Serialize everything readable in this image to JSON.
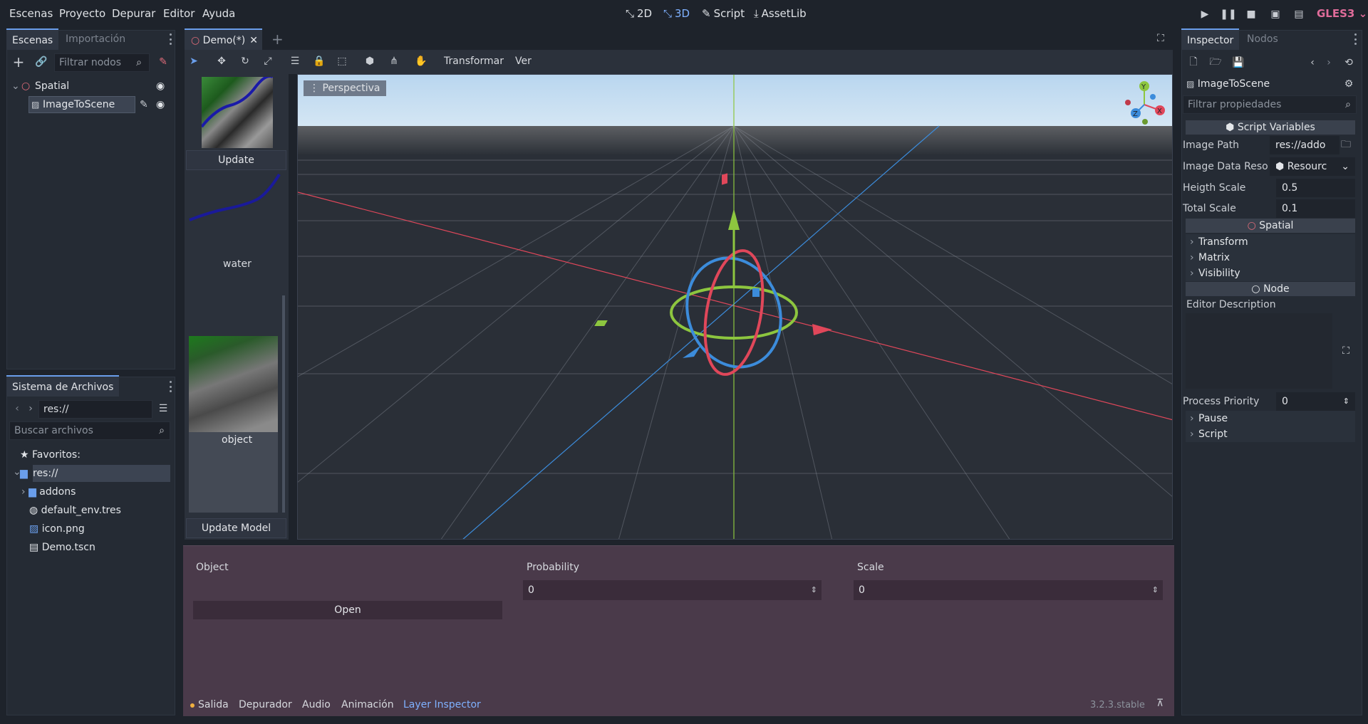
{
  "menu": [
    "Escenas",
    "Proyecto",
    "Depurar",
    "Editor",
    "Ayuda"
  ],
  "modes": {
    "m2d": "2D",
    "m3d": "3D",
    "script": "Script",
    "assetlib": "AssetLib"
  },
  "renderer": "GLES3",
  "scene_panel": {
    "tabs": [
      "Escenas",
      "Importación"
    ],
    "filter_placeholder": "Filtrar nodos",
    "nodes": [
      "Spatial",
      "ImageToScene"
    ]
  },
  "filesystem": {
    "title": "Sistema de Archivos",
    "path": "res://",
    "search_placeholder": "Buscar archivos",
    "items": [
      "Favoritos:",
      "res://",
      "addons",
      "default_env.tres",
      "icon.png",
      "Demo.tscn"
    ]
  },
  "editor_tab": "Demo(*)",
  "toolbar": {
    "transform": "Transformar",
    "view": "Ver"
  },
  "viewport": {
    "label": "Perspectiva"
  },
  "side_panel": {
    "update": "Update",
    "water": "water",
    "object": "object",
    "update_model": "Update Model"
  },
  "bottom_panel": {
    "object_label": "Object",
    "open_button": "Open",
    "probability_label": "Probability",
    "probability_value": "0",
    "scale_label": "Scale",
    "scale_value": "0"
  },
  "bottom_tabs": [
    "Salida",
    "Depurador",
    "Audio",
    "Animación",
    "Layer Inspector"
  ],
  "version": "3.2.3.stable",
  "inspector": {
    "tabs": [
      "Inspector",
      "Nodos"
    ],
    "node_name": "ImageToScene",
    "filter_placeholder": "Filtrar propiedades",
    "script_vars": "Script Variables",
    "props": [
      {
        "label": "Image Path",
        "value": "res://addo"
      },
      {
        "label": "Image Data Reso",
        "value": "Resourc"
      },
      {
        "label": "Heigth Scale",
        "value": "0.5"
      },
      {
        "label": "Total Scale",
        "value": "0.1"
      }
    ],
    "spatial": "Spatial",
    "groups1": [
      "Transform",
      "Matrix",
      "Visibility"
    ],
    "node": "Node",
    "editor_description": "Editor Description",
    "process_priority_label": "Process Priority",
    "process_priority_value": "0",
    "groups2": [
      "Pause",
      "Script"
    ]
  },
  "colors": {
    "accent": "#6a9eeb",
    "bottom_panel": "#4a3a4a",
    "x_axis": "#e0475a",
    "y_axis": "#8dc63f",
    "z_axis": "#3c8cdb"
  }
}
